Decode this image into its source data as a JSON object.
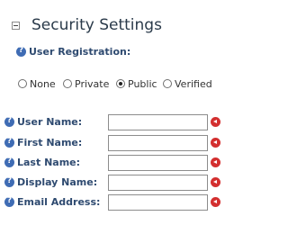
{
  "header": {
    "title": "Security Settings"
  },
  "registration": {
    "label": "User Registration:",
    "options": [
      {
        "label": "None",
        "selected": false
      },
      {
        "label": "Private",
        "selected": false
      },
      {
        "label": "Public",
        "selected": true
      },
      {
        "label": "Verified",
        "selected": false
      }
    ]
  },
  "fields": [
    {
      "label": "User Name:",
      "value": ""
    },
    {
      "label": "First Name:",
      "value": ""
    },
    {
      "label": "Last Name:",
      "value": ""
    },
    {
      "label": "Display Name:",
      "value": ""
    },
    {
      "label": "Email Address:",
      "value": ""
    }
  ],
  "colors": {
    "label": "#2e4a70",
    "help_icon": "#3f6cb4",
    "required_icon": "#d32f2f"
  }
}
